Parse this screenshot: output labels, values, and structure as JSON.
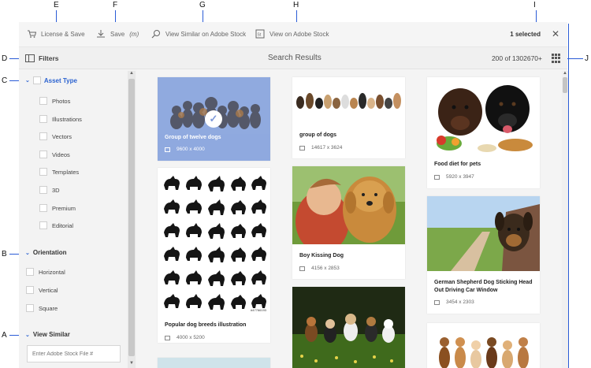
{
  "callouts": {
    "A": "A",
    "B": "B",
    "C": "C",
    "D": "D",
    "E": "E",
    "F": "F",
    "G": "G",
    "H": "H",
    "I": "I",
    "J": "J"
  },
  "actionbar": {
    "license_save": "License & Save",
    "save": "Save",
    "save_suffix": "(m)",
    "view_similar": "View Similar on Adobe Stock",
    "view_on_stock": "View on Adobe Stock",
    "selected_count": "1 selected",
    "close": "✕"
  },
  "filterbar": {
    "filters_label": "Filters",
    "title": "Search Results",
    "count": "200 of 1302670+"
  },
  "sidebar": {
    "asset_type": {
      "label": "Asset Type",
      "options": [
        "Photos",
        "Illustrations",
        "Vectors",
        "Videos",
        "Templates",
        "3D",
        "Premium",
        "Editorial"
      ]
    },
    "orientation": {
      "label": "Orientation",
      "options": [
        "Horizontal",
        "Vertical",
        "Square"
      ]
    },
    "view_similar": {
      "label": "View Similar",
      "placeholder": "Enter Adobe Stock File #"
    }
  },
  "results": {
    "cards": [
      {
        "title": "Group of twelve dogs",
        "dims": "9600 x 4000"
      },
      {
        "title": "Popular dog breeds illustration",
        "dims": "4000 x 5200"
      },
      {
        "title": "group of dogs",
        "dims": "14617 x 3624"
      },
      {
        "title": "Boy Kissing Dog",
        "dims": "4156 x 2853"
      },
      {
        "title": "Food diet for pets",
        "dims": "5920 x 3947"
      },
      {
        "title": "German Shepherd Dog Sticking Head Out Driving Car Window",
        "dims": "3454 x 2303"
      }
    ],
    "stock_id": "#47766193"
  },
  "colors": {
    "accent": "#2c63d0",
    "selected_card": "#8fa9df",
    "callout_line": "#2b5cd6"
  }
}
